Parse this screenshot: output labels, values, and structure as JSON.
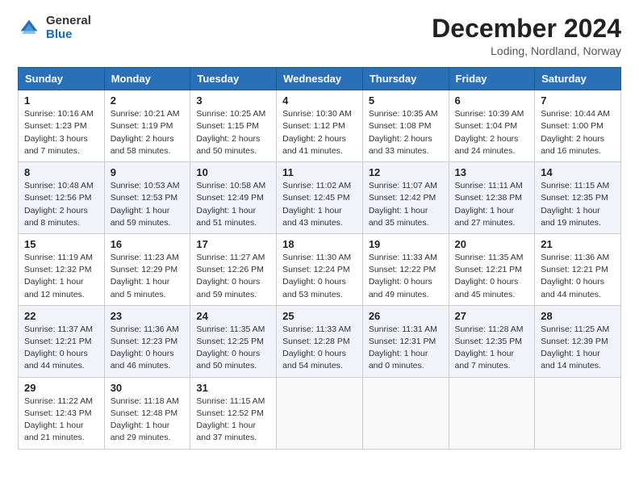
{
  "logo": {
    "general": "General",
    "blue": "Blue"
  },
  "title": "December 2024",
  "location": "Loding, Nordland, Norway",
  "days_of_week": [
    "Sunday",
    "Monday",
    "Tuesday",
    "Wednesday",
    "Thursday",
    "Friday",
    "Saturday"
  ],
  "weeks": [
    [
      {
        "day": "1",
        "info": "Sunrise: 10:16 AM\nSunset: 1:23 PM\nDaylight: 3 hours and 7 minutes."
      },
      {
        "day": "2",
        "info": "Sunrise: 10:21 AM\nSunset: 1:19 PM\nDaylight: 2 hours and 58 minutes."
      },
      {
        "day": "3",
        "info": "Sunrise: 10:25 AM\nSunset: 1:15 PM\nDaylight: 2 hours and 50 minutes."
      },
      {
        "day": "4",
        "info": "Sunrise: 10:30 AM\nSunset: 1:12 PM\nDaylight: 2 hours and 41 minutes."
      },
      {
        "day": "5",
        "info": "Sunrise: 10:35 AM\nSunset: 1:08 PM\nDaylight: 2 hours and 33 minutes."
      },
      {
        "day": "6",
        "info": "Sunrise: 10:39 AM\nSunset: 1:04 PM\nDaylight: 2 hours and 24 minutes."
      },
      {
        "day": "7",
        "info": "Sunrise: 10:44 AM\nSunset: 1:00 PM\nDaylight: 2 hours and 16 minutes."
      }
    ],
    [
      {
        "day": "8",
        "info": "Sunrise: 10:48 AM\nSunset: 12:56 PM\nDaylight: 2 hours and 8 minutes."
      },
      {
        "day": "9",
        "info": "Sunrise: 10:53 AM\nSunset: 12:53 PM\nDaylight: 1 hour and 59 minutes."
      },
      {
        "day": "10",
        "info": "Sunrise: 10:58 AM\nSunset: 12:49 PM\nDaylight: 1 hour and 51 minutes."
      },
      {
        "day": "11",
        "info": "Sunrise: 11:02 AM\nSunset: 12:45 PM\nDaylight: 1 hour and 43 minutes."
      },
      {
        "day": "12",
        "info": "Sunrise: 11:07 AM\nSunset: 12:42 PM\nDaylight: 1 hour and 35 minutes."
      },
      {
        "day": "13",
        "info": "Sunrise: 11:11 AM\nSunset: 12:38 PM\nDaylight: 1 hour and 27 minutes."
      },
      {
        "day": "14",
        "info": "Sunrise: 11:15 AM\nSunset: 12:35 PM\nDaylight: 1 hour and 19 minutes."
      }
    ],
    [
      {
        "day": "15",
        "info": "Sunrise: 11:19 AM\nSunset: 12:32 PM\nDaylight: 1 hour and 12 minutes."
      },
      {
        "day": "16",
        "info": "Sunrise: 11:23 AM\nSunset: 12:29 PM\nDaylight: 1 hour and 5 minutes."
      },
      {
        "day": "17",
        "info": "Sunrise: 11:27 AM\nSunset: 12:26 PM\nDaylight: 0 hours and 59 minutes."
      },
      {
        "day": "18",
        "info": "Sunrise: 11:30 AM\nSunset: 12:24 PM\nDaylight: 0 hours and 53 minutes."
      },
      {
        "day": "19",
        "info": "Sunrise: 11:33 AM\nSunset: 12:22 PM\nDaylight: 0 hours and 49 minutes."
      },
      {
        "day": "20",
        "info": "Sunrise: 11:35 AM\nSunset: 12:21 PM\nDaylight: 0 hours and 45 minutes."
      },
      {
        "day": "21",
        "info": "Sunrise: 11:36 AM\nSunset: 12:21 PM\nDaylight: 0 hours and 44 minutes."
      }
    ],
    [
      {
        "day": "22",
        "info": "Sunrise: 11:37 AM\nSunset: 12:21 PM\nDaylight: 0 hours and 44 minutes."
      },
      {
        "day": "23",
        "info": "Sunrise: 11:36 AM\nSunset: 12:23 PM\nDaylight: 0 hours and 46 minutes."
      },
      {
        "day": "24",
        "info": "Sunrise: 11:35 AM\nSunset: 12:25 PM\nDaylight: 0 hours and 50 minutes."
      },
      {
        "day": "25",
        "info": "Sunrise: 11:33 AM\nSunset: 12:28 PM\nDaylight: 0 hours and 54 minutes."
      },
      {
        "day": "26",
        "info": "Sunrise: 11:31 AM\nSunset: 12:31 PM\nDaylight: 1 hour and 0 minutes."
      },
      {
        "day": "27",
        "info": "Sunrise: 11:28 AM\nSunset: 12:35 PM\nDaylight: 1 hour and 7 minutes."
      },
      {
        "day": "28",
        "info": "Sunrise: 11:25 AM\nSunset: 12:39 PM\nDaylight: 1 hour and 14 minutes."
      }
    ],
    [
      {
        "day": "29",
        "info": "Sunrise: 11:22 AM\nSunset: 12:43 PM\nDaylight: 1 hour and 21 minutes."
      },
      {
        "day": "30",
        "info": "Sunrise: 11:18 AM\nSunset: 12:48 PM\nDaylight: 1 hour and 29 minutes."
      },
      {
        "day": "31",
        "info": "Sunrise: 11:15 AM\nSunset: 12:52 PM\nDaylight: 1 hour and 37 minutes."
      },
      null,
      null,
      null,
      null
    ]
  ]
}
